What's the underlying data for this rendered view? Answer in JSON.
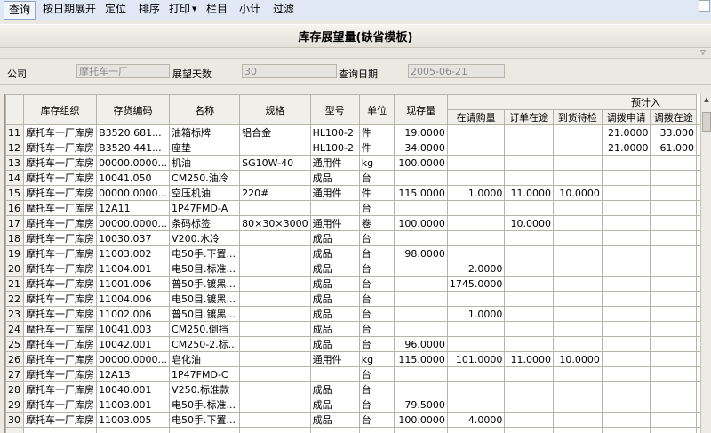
{
  "menu": {
    "items": [
      {
        "name": "menu-query",
        "label": "查询"
      },
      {
        "name": "menu-expand-by-date",
        "label": "按日期展开"
      },
      {
        "name": "menu-locate",
        "label": "定位"
      },
      {
        "name": "menu-sort",
        "label": "排序"
      },
      {
        "name": "menu-print",
        "label": "打印"
      },
      {
        "name": "menu-columns",
        "label": "栏目"
      },
      {
        "name": "menu-subtotal",
        "label": "小计"
      },
      {
        "name": "menu-filter",
        "label": "过滤"
      }
    ]
  },
  "page": {
    "title": "库存展望量(缺省模板)"
  },
  "filters": {
    "company_label": "公司",
    "company_value": "摩托车一厂",
    "days_label": "展望天数",
    "days_value": "30",
    "date_label": "查询日期",
    "date_value": "2005-06-21"
  },
  "grid": {
    "group_header": "预计入",
    "headers": [
      "库存组织",
      "存货编码",
      "名称",
      "规格",
      "型号",
      "单位",
      "现存量",
      "在请购量",
      "订单在途",
      "到货待检",
      "调拨申请",
      "调拨在途"
    ],
    "rows": [
      {
        "no": "11",
        "org": "摩托车一厂库房",
        "code": "B3520.681...",
        "name": "油箱标牌",
        "spec": "铝合金",
        "model": "HL100-2",
        "unit": "件",
        "onhand": "19.0000",
        "pr": "",
        "po": "",
        "inspect": "",
        "tr_req": "21.0000",
        "tr_transit": "33.000"
      },
      {
        "no": "12",
        "org": "摩托车一厂库房",
        "code": "B3520.441...",
        "name": "座垫",
        "spec": "",
        "model": "HL100-2",
        "unit": "件",
        "onhand": "34.0000",
        "pr": "",
        "po": "",
        "inspect": "",
        "tr_req": "21.0000",
        "tr_transit": "61.000"
      },
      {
        "no": "13",
        "org": "摩托车一厂库房",
        "code": "00000.0000...",
        "name": "机油",
        "spec": "SG10W-40",
        "model": "通用件",
        "unit": "kg",
        "onhand": "100.0000",
        "pr": "",
        "po": "",
        "inspect": "",
        "tr_req": "",
        "tr_transit": ""
      },
      {
        "no": "14",
        "org": "摩托车一厂库房",
        "code": "10041.050",
        "name": "CM250.油冷",
        "spec": "",
        "model": "成品",
        "unit": "台",
        "onhand": "",
        "pr": "",
        "po": "",
        "inspect": "",
        "tr_req": "",
        "tr_transit": ""
      },
      {
        "no": "15",
        "org": "摩托车一厂库房",
        "code": "00000.0000...",
        "name": "空压机油",
        "spec": "220#",
        "model": "通用件",
        "unit": "件",
        "onhand": "115.0000",
        "pr": "1.0000",
        "po": "11.0000",
        "inspect": "10.0000",
        "tr_req": "",
        "tr_transit": ""
      },
      {
        "no": "16",
        "org": "摩托车一厂库房",
        "code": "12A11",
        "name": "1P47FMD-A",
        "spec": "",
        "model": "",
        "unit": "台",
        "onhand": "",
        "pr": "",
        "po": "",
        "inspect": "",
        "tr_req": "",
        "tr_transit": ""
      },
      {
        "no": "17",
        "org": "摩托车一厂库房",
        "code": "00000.0000...",
        "name": "条码标签",
        "spec": "80×30×3000",
        "model": "通用件",
        "unit": "卷",
        "onhand": "100.0000",
        "pr": "",
        "po": "10.0000",
        "inspect": "",
        "tr_req": "",
        "tr_transit": ""
      },
      {
        "no": "18",
        "org": "摩托车一厂库房",
        "code": "10030.037",
        "name": "V200.水冷",
        "spec": "",
        "model": "成品",
        "unit": "台",
        "onhand": "",
        "pr": "",
        "po": "",
        "inspect": "",
        "tr_req": "",
        "tr_transit": ""
      },
      {
        "no": "19",
        "org": "摩托车一厂库房",
        "code": "11003.002",
        "name": "电50手.下置...",
        "spec": "",
        "model": "成品",
        "unit": "台",
        "onhand": "98.0000",
        "pr": "",
        "po": "",
        "inspect": "",
        "tr_req": "",
        "tr_transit": ""
      },
      {
        "no": "20",
        "org": "摩托车一厂库房",
        "code": "11004.001",
        "name": "电50目.标准...",
        "spec": "",
        "model": "成品",
        "unit": "台",
        "onhand": "",
        "pr": "2.0000",
        "po": "",
        "inspect": "",
        "tr_req": "",
        "tr_transit": ""
      },
      {
        "no": "21",
        "org": "摩托车一厂库房",
        "code": "11001.006",
        "name": "普50手.镀黑...",
        "spec": "",
        "model": "成品",
        "unit": "台",
        "onhand": "",
        "pr": "1745.0000",
        "po": "",
        "inspect": "",
        "tr_req": "",
        "tr_transit": ""
      },
      {
        "no": "22",
        "org": "摩托车一厂库房",
        "code": "11004.006",
        "name": "电50目.镀黑...",
        "spec": "",
        "model": "成品",
        "unit": "台",
        "onhand": "",
        "pr": "",
        "po": "",
        "inspect": "",
        "tr_req": "",
        "tr_transit": ""
      },
      {
        "no": "23",
        "org": "摩托车一厂库房",
        "code": "11002.006",
        "name": "普50目.镀黑...",
        "spec": "",
        "model": "成品",
        "unit": "台",
        "onhand": "",
        "pr": "1.0000",
        "po": "",
        "inspect": "",
        "tr_req": "",
        "tr_transit": ""
      },
      {
        "no": "24",
        "org": "摩托车一厂库房",
        "code": "10041.003",
        "name": "CM250.倒挡",
        "spec": "",
        "model": "成品",
        "unit": "台",
        "onhand": "",
        "pr": "",
        "po": "",
        "inspect": "",
        "tr_req": "",
        "tr_transit": ""
      },
      {
        "no": "25",
        "org": "摩托车一厂库房",
        "code": "10042.001",
        "name": "CM250-2.标...",
        "spec": "",
        "model": "成品",
        "unit": "台",
        "onhand": "96.0000",
        "pr": "",
        "po": "",
        "inspect": "",
        "tr_req": "",
        "tr_transit": ""
      },
      {
        "no": "26",
        "org": "摩托车一厂库房",
        "code": "00000.0000...",
        "name": "皂化油",
        "spec": "",
        "model": "通用件",
        "unit": "kg",
        "onhand": "115.0000",
        "pr": "101.0000",
        "po": "11.0000",
        "inspect": "10.0000",
        "tr_req": "",
        "tr_transit": ""
      },
      {
        "no": "27",
        "org": "摩托车一厂库房",
        "code": "12A13",
        "name": "1P47FMD-C",
        "spec": "",
        "model": "",
        "unit": "台",
        "onhand": "",
        "pr": "",
        "po": "",
        "inspect": "",
        "tr_req": "",
        "tr_transit": ""
      },
      {
        "no": "28",
        "org": "摩托车一厂库房",
        "code": "10040.001",
        "name": "V250.标准款",
        "spec": "",
        "model": "成品",
        "unit": "台",
        "onhand": "",
        "pr": "",
        "po": "",
        "inspect": "",
        "tr_req": "",
        "tr_transit": ""
      },
      {
        "no": "29",
        "org": "摩托车一厂库房",
        "code": "11003.001",
        "name": "电50手.标准...",
        "spec": "",
        "model": "成品",
        "unit": "台",
        "onhand": "79.5000",
        "pr": "",
        "po": "",
        "inspect": "",
        "tr_req": "",
        "tr_transit": ""
      },
      {
        "no": "30",
        "org": "摩托车一厂库房",
        "code": "11003.005",
        "name": "电50手.下置...",
        "spec": "",
        "model": "成品",
        "unit": "台",
        "onhand": "100.0000",
        "pr": "4.0000",
        "po": "",
        "inspect": "",
        "tr_req": "",
        "tr_transit": ""
      }
    ]
  }
}
